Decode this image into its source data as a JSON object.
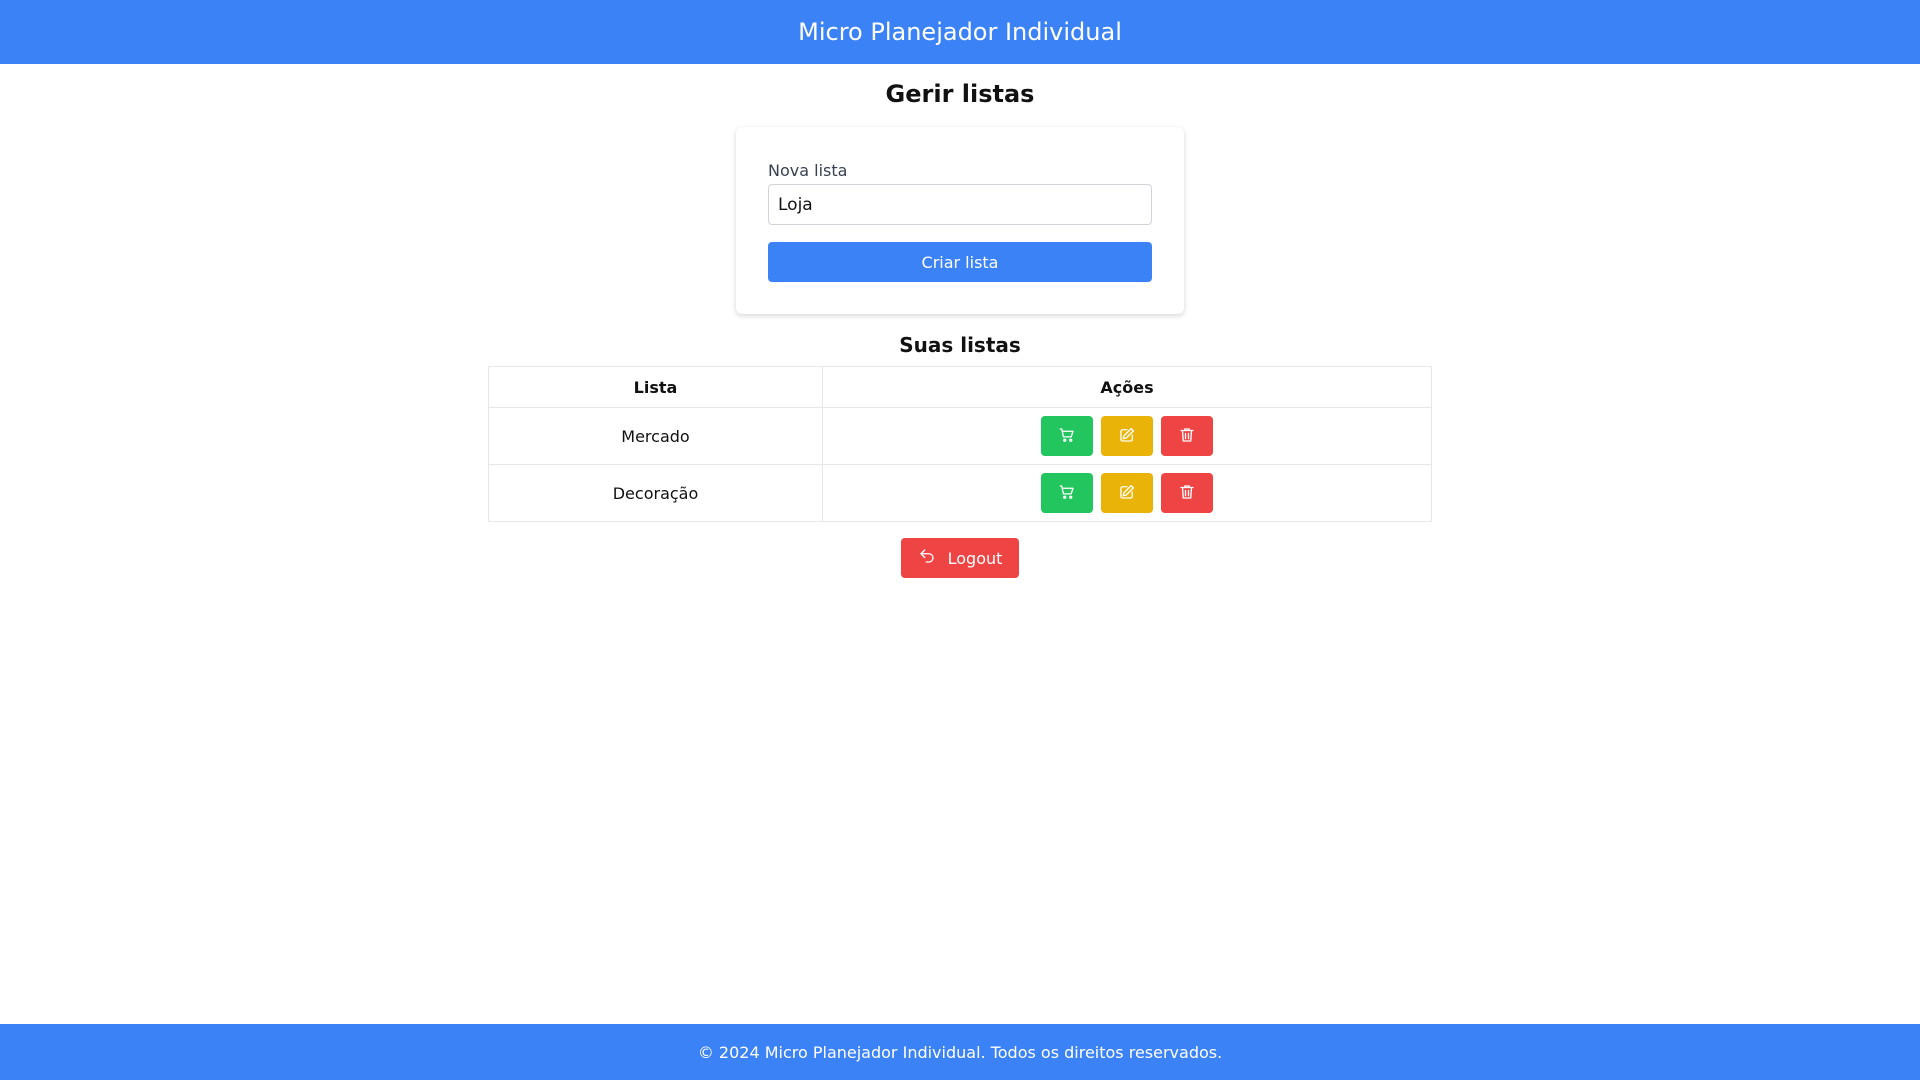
{
  "header": {
    "title": "Micro Planejador Individual"
  },
  "main": {
    "title": "Gerir listas",
    "form": {
      "label": "Nova lista",
      "input_value": "Loja",
      "submit_label": "Criar lista"
    },
    "lists_section": {
      "title": "Suas listas",
      "columns": [
        "Lista",
        "Ações"
      ],
      "rows": [
        {
          "name": "Mercado",
          "actions": [
            "cart-icon",
            "edit-icon",
            "trash-icon"
          ]
        },
        {
          "name": "Decoração",
          "actions": [
            "cart-icon",
            "edit-icon",
            "trash-icon"
          ]
        }
      ]
    },
    "logout": {
      "label": "Logout",
      "icon": "undo-arrow-icon"
    }
  },
  "footer": {
    "text": "© 2024 Micro Planejador Individual. Todos os direitos reservados."
  },
  "colors": {
    "primary": "#3b82f6",
    "success": "#22c55e",
    "warning": "#eab308",
    "danger": "#ef4444"
  }
}
